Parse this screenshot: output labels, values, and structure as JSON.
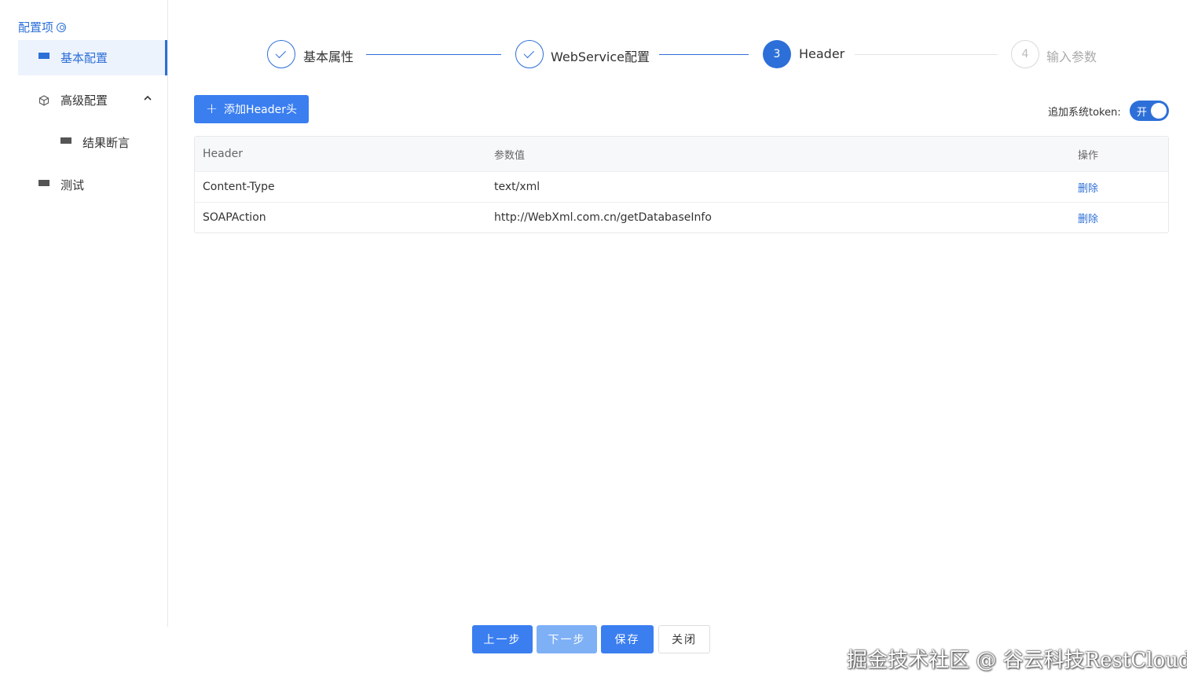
{
  "sidebar": {
    "title": "配置项",
    "items": [
      {
        "label": "基本配置",
        "active": true
      },
      {
        "label": "高级配置"
      },
      {
        "label": "结果断言"
      },
      {
        "label": "测试"
      }
    ]
  },
  "steps": [
    {
      "number": "1",
      "label": "基本属性",
      "status": "done"
    },
    {
      "number": "2",
      "label": "WebService配置",
      "status": "done"
    },
    {
      "number": "3",
      "label": "Header",
      "status": "current"
    },
    {
      "number": "4",
      "label": "输入参数",
      "status": "pending"
    }
  ],
  "toolbar": {
    "add_label": "添加Header头",
    "token_label": "追加系统token:",
    "token_toggle_text": "开"
  },
  "table": {
    "headers": [
      "Header",
      "参数值",
      "操作"
    ],
    "rows": [
      {
        "header": "Content-Type",
        "value": "text/xml",
        "action": "删除"
      },
      {
        "header": "SOAPAction",
        "value": "http://WebXml.com.cn/getDatabaseInfo",
        "action": "删除"
      }
    ]
  },
  "footer": {
    "prev": "上一步",
    "next": "下一步",
    "save": "保存",
    "close": "关闭"
  },
  "watermark": "掘金技术社区 @ 谷云科技RestCloud",
  "colors": {
    "accent": "#2d6fd8",
    "button": "#3a7ef0",
    "disabled_button": "#7eb0f6"
  }
}
